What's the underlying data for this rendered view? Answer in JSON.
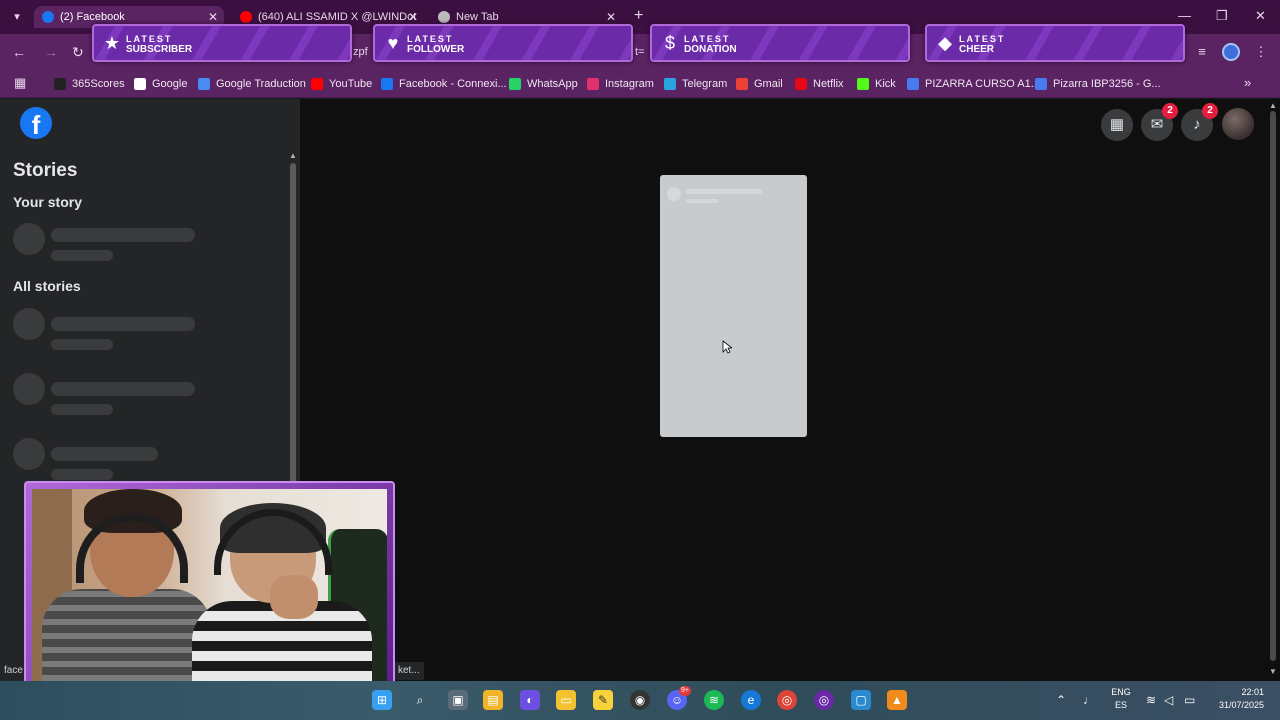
{
  "browser": {
    "tabs": [
      {
        "label": "(2) Facebook",
        "active": true
      },
      {
        "label": "(640) ALI SSAMID X @LWINDot",
        "active": false
      },
      {
        "label": "New Tab",
        "active": false
      }
    ],
    "close_glyph": "✕",
    "new_tab_glyph": "+",
    "omnibox_fragments": [
      "zpf",
      "t="
    ]
  },
  "alerts": [
    {
      "top": "LATEST",
      "bottom": "SUBSCRIBER",
      "icon": "star-icon"
    },
    {
      "top": "LATEST",
      "bottom": "FOLLOWER",
      "icon": "heart-icon"
    },
    {
      "top": "LATEST",
      "bottom": "DONATION",
      "icon": "dollar-icon"
    },
    {
      "top": "LATEST",
      "bottom": "CHEER",
      "icon": "diamond-icon"
    }
  ],
  "bookmarks": [
    {
      "label": "365Scores",
      "color": "#222222"
    },
    {
      "label": "Google",
      "color": "#ffffff"
    },
    {
      "label": "Google Traduction",
      "color": "#4a8af4"
    },
    {
      "label": "YouTube",
      "color": "#ff0000"
    },
    {
      "label": "Facebook - Connexi...",
      "color": "#1877f2"
    },
    {
      "label": "WhatsApp",
      "color": "#25d366"
    },
    {
      "label": "Instagram",
      "color": "#e1306c"
    },
    {
      "label": "Telegram",
      "color": "#2aa3e0"
    },
    {
      "label": "Gmail",
      "color": "#ea4335"
    },
    {
      "label": "Netflix",
      "color": "#e50914"
    },
    {
      "label": "Kick",
      "color": "#53fc18"
    },
    {
      "label": "PIZARRA CURSO A1...",
      "color": "#4a7af0"
    },
    {
      "label": "Pizarra IBP3256 - G...",
      "color": "#4a7af0"
    }
  ],
  "facebook": {
    "logo_letter": "f",
    "stories_title": "Stories",
    "your_story": "Your story",
    "all_stories": "All stories",
    "messenger_badge": "2",
    "notifications_badge": "2",
    "brand_color": "#1877f2"
  },
  "status_bar": {
    "left": "face",
    "right": "ket..."
  },
  "taskbar": {
    "lang_top": "ENG",
    "lang_bottom": "ES",
    "time": "22:01",
    "date": "31/07/2025",
    "discord_badge": "9+"
  }
}
